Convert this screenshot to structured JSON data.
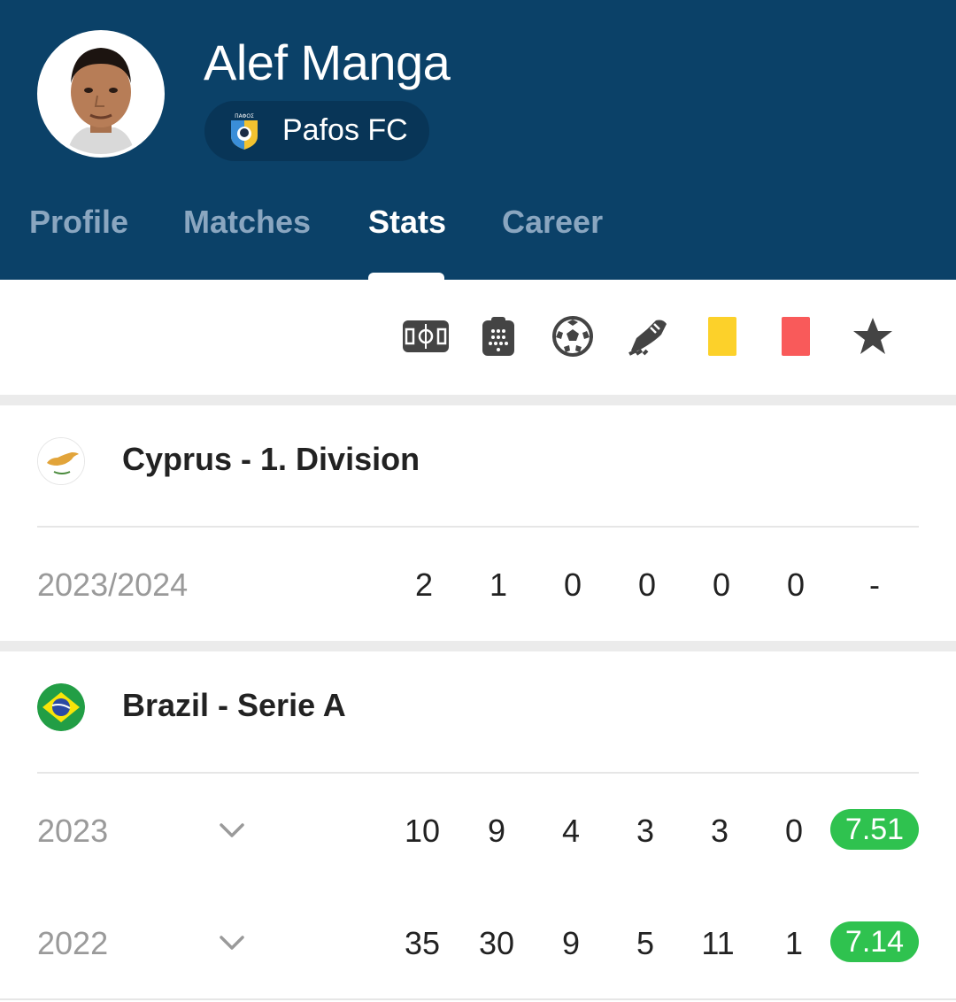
{
  "player": {
    "name": "Alef Manga",
    "team": "Pafos FC",
    "crest_text": "ΠΑΦΟΣ"
  },
  "tabs": [
    {
      "label": "Profile",
      "active": false
    },
    {
      "label": "Matches",
      "active": false
    },
    {
      "label": "Stats",
      "active": true
    },
    {
      "label": "Career",
      "active": false
    }
  ],
  "stat_columns": [
    {
      "icon": "pitch-icon"
    },
    {
      "icon": "lineup-clipboard-icon"
    },
    {
      "icon": "football-icon"
    },
    {
      "icon": "football-boot-icon"
    },
    {
      "icon": "yellow-card-icon"
    },
    {
      "icon": "red-card-icon"
    },
    {
      "icon": "star-icon"
    }
  ],
  "colors": {
    "header_bg": "#0b4168",
    "rating_green": "#2fc24f",
    "yellow_card": "#fcd12a",
    "red_card": "#f95a5a"
  },
  "leagues": [
    {
      "name": "Cyprus - 1. Division",
      "logo": "cyprus-flag-icon",
      "seasons": [
        {
          "season": "2023/2024",
          "expandable": false,
          "stats": [
            "2",
            "1",
            "0",
            "0",
            "0",
            "0"
          ],
          "rating": "-"
        }
      ]
    },
    {
      "name": "Brazil - Serie A",
      "logo": "brazil-flag-icon",
      "seasons": [
        {
          "season": "2023",
          "expandable": true,
          "stats": [
            "10",
            "9",
            "4",
            "3",
            "3",
            "0"
          ],
          "rating": "7.51"
        },
        {
          "season": "2022",
          "expandable": true,
          "stats": [
            "35",
            "30",
            "9",
            "5",
            "11",
            "1"
          ],
          "rating": "7.14"
        }
      ]
    }
  ]
}
